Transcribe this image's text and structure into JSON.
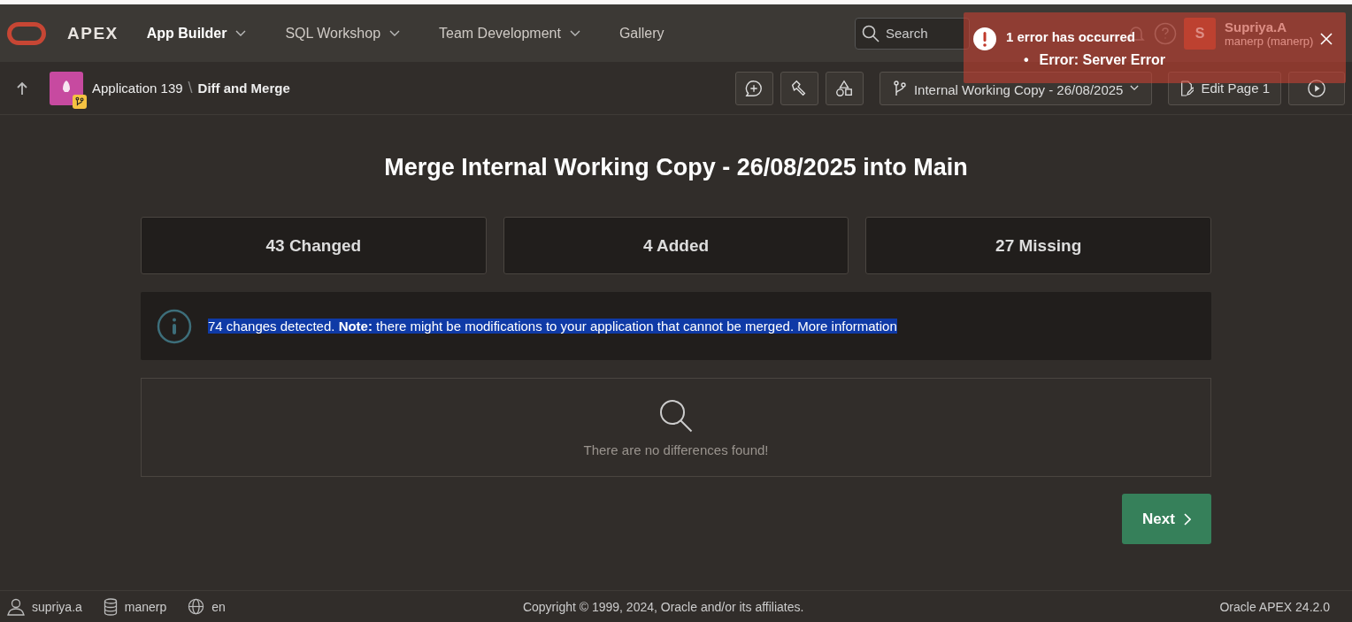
{
  "header": {
    "logo_text": "APEX",
    "nav": [
      {
        "label": "App Builder",
        "selected": true,
        "has_menu": true
      },
      {
        "label": "SQL Workshop",
        "selected": false,
        "has_menu": true
      },
      {
        "label": "Team Development",
        "selected": false,
        "has_menu": true
      },
      {
        "label": "Gallery",
        "selected": false,
        "has_menu": false
      }
    ],
    "search": {
      "placeholder": "Search"
    },
    "user": {
      "initial": "S",
      "name": "Supriya.A",
      "workspace": "manerp (manerp)"
    }
  },
  "toolbar": {
    "app_label": "Application 139",
    "separator": "\\",
    "page_title": "Diff and Merge",
    "branch": "Internal Working Copy - 26/08/2025",
    "edit_button": "Edit Page 1"
  },
  "error_toast": {
    "title": "1 error has occurred",
    "errors": [
      {
        "bullet": "•",
        "text": "Error: Server Error"
      }
    ]
  },
  "main": {
    "title": "Merge Internal Working Copy - 26/08/2025 into Main",
    "stats": [
      "43 Changed",
      "4 Added",
      "27 Missing"
    ],
    "message": {
      "text": "74 changes detected. **Note:** there might be modifications to your application that cannot be merged. More information",
      "highlighted": true
    },
    "empty_text": "There are no differences found!",
    "next_button": "Next"
  },
  "footer": {
    "user": "supriya.a",
    "schema": "manerp",
    "language": "en",
    "copyright": "Copyright © 1999, 2024, Oracle and/or its affiliates.",
    "version": "Oracle APEX 24.2.0"
  }
}
